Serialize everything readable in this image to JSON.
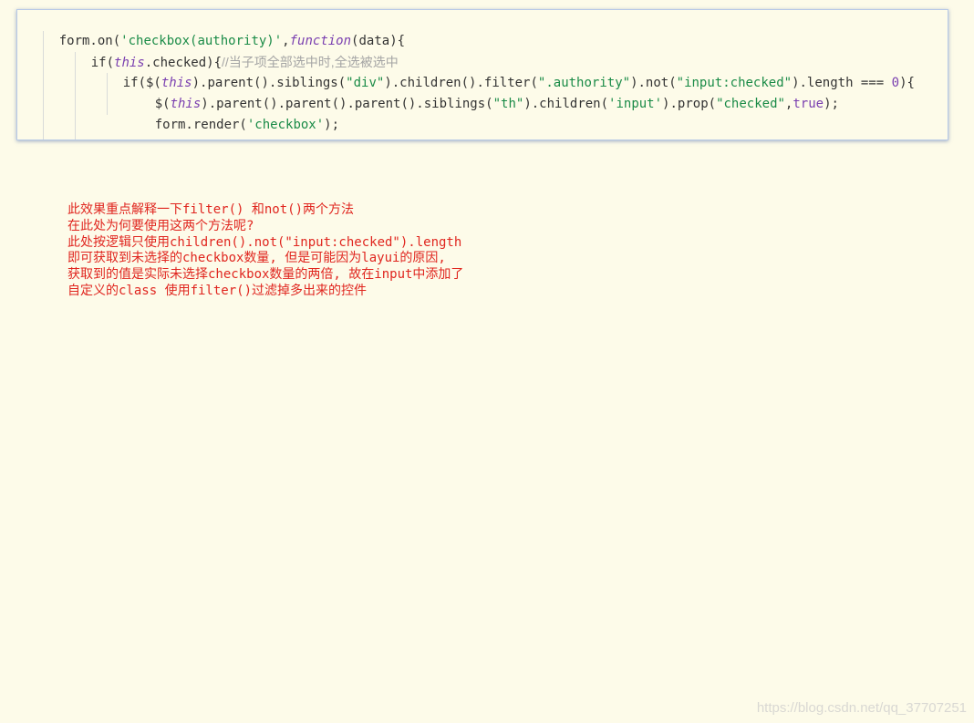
{
  "code": {
    "line1": {
      "t1": "form.on(",
      "t2": "'checkbox(authority)'",
      "t3": ",",
      "t4": "function",
      "t5": "(data){"
    },
    "line2": {
      "t1": "if(",
      "t2": "this",
      "t3": ".checked){",
      "t4": "//当子项全部选中时,全选被选中"
    },
    "line3": {
      "t1": "if($(",
      "t2": "this",
      "t3": ").parent().siblings(",
      "t4": "\"div\"",
      "t5": ").children().filter(",
      "t6": "\".authority\"",
      "t7": ").not(",
      "t8": "\"input:checked\"",
      "t9": ").length === ",
      "t10": "0",
      "t11": "){"
    },
    "line4": {
      "t1": "$(",
      "t2": "this",
      "t3": ").parent().parent().parent().siblings(",
      "t4": "\"th\"",
      "t5": ").children(",
      "t6": "'input'",
      "t7": ").prop(",
      "t8": "\"checked\"",
      "t9": ",",
      "t10": "true",
      "t11": ");"
    },
    "line5": {
      "t1": "form.render(",
      "t2": "'checkbox'",
      "t3": ");"
    },
    "line6": {
      "t1": "}"
    }
  },
  "notes": [
    "此效果重点解释一下filter() 和not()两个方法",
    "在此处为何要使用这两个方法呢?",
    "此处按逻辑只使用children().not(\"input:checked\").length",
    "即可获取到未选择的checkbox数量, 但是可能因为layui的原因,",
    "获取到的值是实际未选择checkbox数量的两倍, 故在input中添加了",
    "自定义的class 使用filter()过滤掉多出来的控件"
  ],
  "watermark": "https://blog.csdn.net/qq_37707251",
  "colors": {
    "background": "#fdfbe9",
    "code_string": "#1a8b47",
    "code_keyword": "#7a3fb0",
    "code_comment": "#a4a4a4",
    "notes_text": "#e0261f",
    "card_border": "#b7c9e6"
  }
}
